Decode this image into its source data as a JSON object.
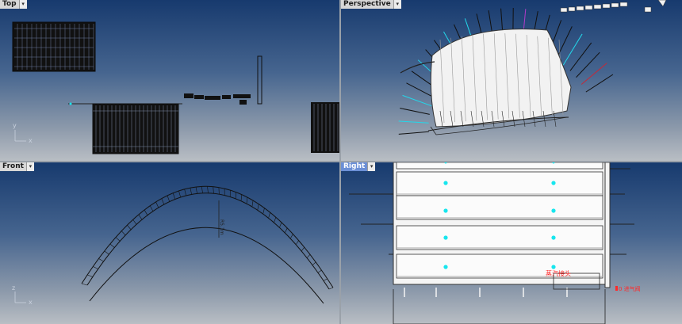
{
  "viewports": {
    "top": {
      "label": "Top"
    },
    "perspective": {
      "label": "Perspective"
    },
    "front": {
      "label": "Front"
    },
    "right": {
      "label": "Right"
    }
  },
  "dropdown_glyph": "▾",
  "axes": {
    "x": "x",
    "y": "y",
    "z": "z"
  },
  "annotations": {
    "steam_connector": "蒸汽接头",
    "pipe_connector": "0 进气阀"
  },
  "colors": {
    "active_tab": "#6b8fd6",
    "highlight": "#ff2a2a",
    "marker": "#17e6ee"
  }
}
